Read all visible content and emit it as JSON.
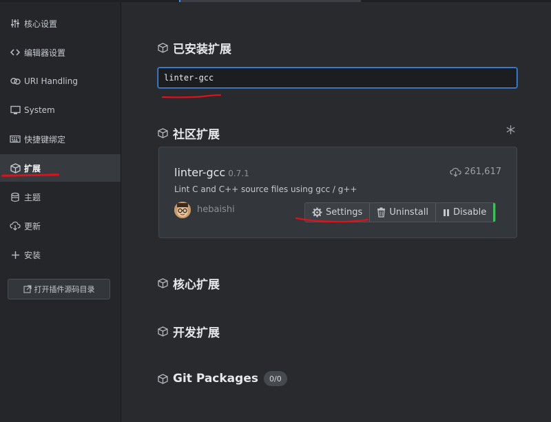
{
  "sidebar": {
    "items": [
      {
        "label": "核心设置",
        "icon": "sliders-icon",
        "active": false
      },
      {
        "label": "编辑器设置",
        "icon": "code-icon",
        "active": false
      },
      {
        "label": "URI Handling",
        "icon": "link-icon",
        "active": false
      },
      {
        "label": "System",
        "icon": "monitor-icon",
        "active": false
      },
      {
        "label": "快捷键绑定",
        "icon": "keyboard-icon",
        "active": false
      },
      {
        "label": "扩展",
        "icon": "package-icon",
        "active": true
      },
      {
        "label": "主题",
        "icon": "paintcan-icon",
        "active": false
      },
      {
        "label": "更新",
        "icon": "cloud-download-icon",
        "active": false
      },
      {
        "label": "安装",
        "icon": "plus-icon",
        "active": false
      }
    ],
    "open_dir_button": "打开插件源码目录"
  },
  "main": {
    "installed_title": "已安装扩展",
    "search_value": "linter-gcc",
    "community_title": "社区扩展",
    "package": {
      "name": "linter-gcc",
      "version": "0.7.1",
      "description": "Lint C and C++ source files using gcc / g++",
      "downloads": "261,617",
      "author": "hebaishi",
      "buttons": {
        "settings": "Settings",
        "uninstall": "Uninstall",
        "disable": "Disable"
      }
    },
    "core_title": "核心扩展",
    "dev_title": "开发扩展",
    "git_title": "Git Packages",
    "git_count": "0/0"
  },
  "colors": {
    "accent": "#4a8fe7",
    "annotation": "#e0111b",
    "enabled": "#3ec15a"
  }
}
